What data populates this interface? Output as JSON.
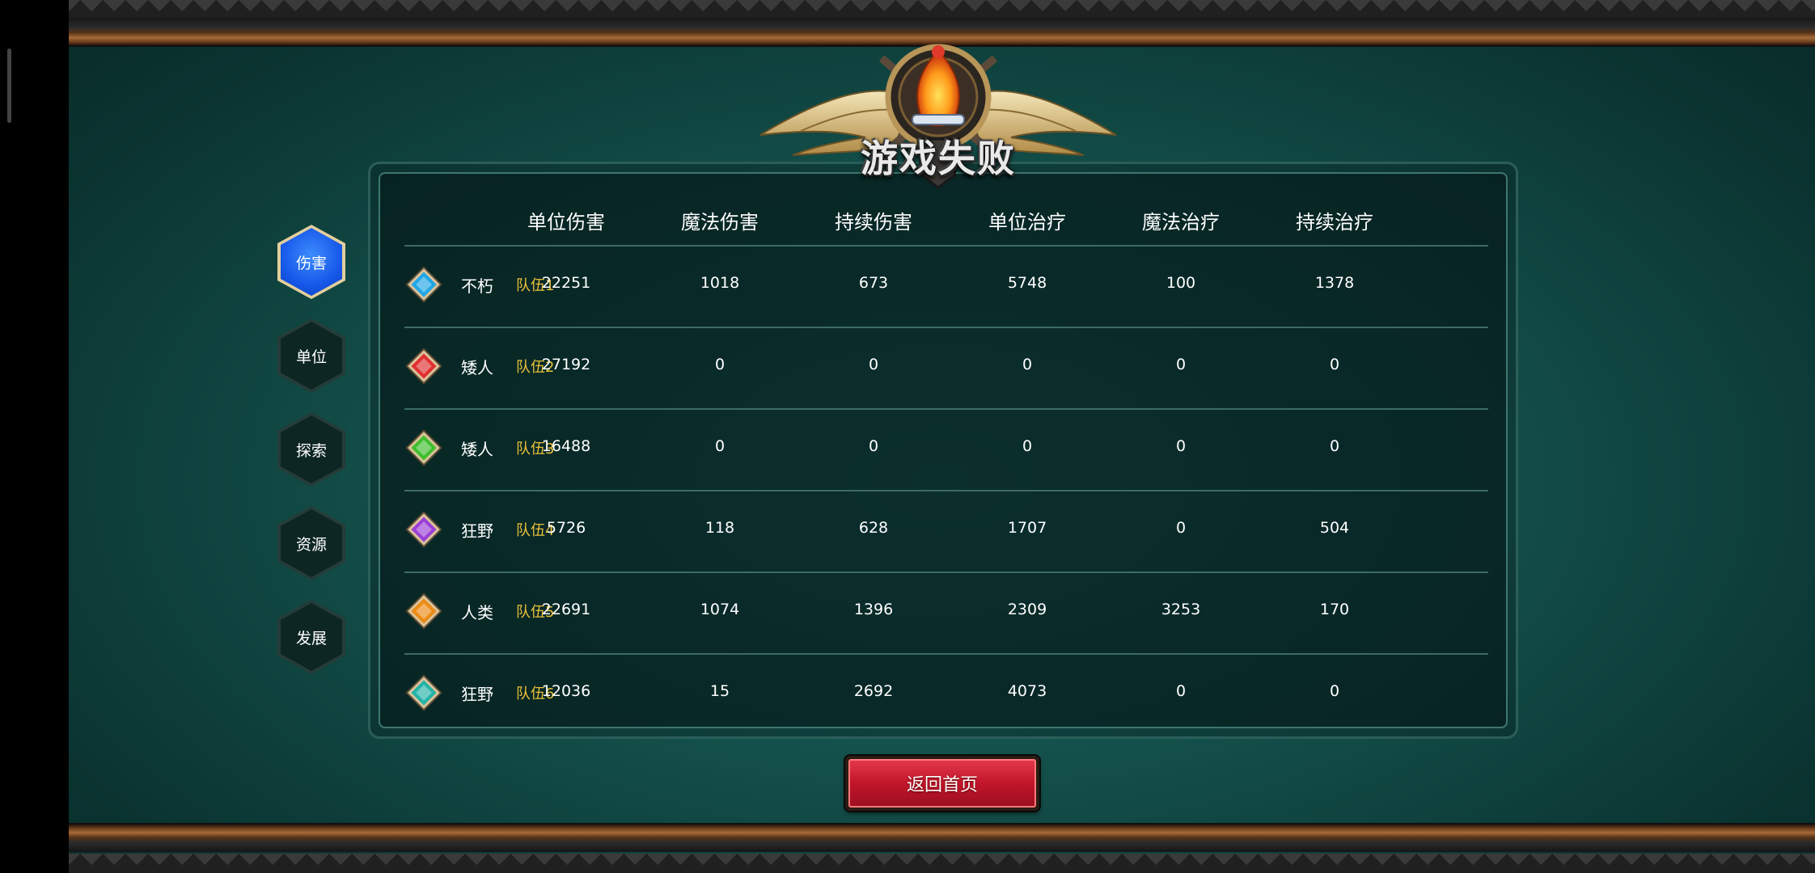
{
  "result_title": "游戏失败",
  "tabs": [
    {
      "label": "伤害",
      "active": true
    },
    {
      "label": "单位",
      "active": false
    },
    {
      "label": "探索",
      "active": false
    },
    {
      "label": "资源",
      "active": false
    },
    {
      "label": "发展",
      "active": false
    }
  ],
  "table": {
    "headers": [
      "单位伤害",
      "魔法伤害",
      "持续伤害",
      "单位治疗",
      "魔法治疗",
      "持续治疗"
    ],
    "rows": [
      {
        "gem_color": "#1fa6e6",
        "race": "不朽",
        "team": "队伍1",
        "values": [
          "22251",
          "1018",
          "673",
          "5748",
          "100",
          "1378"
        ]
      },
      {
        "gem_color": "#e13030",
        "race": "矮人",
        "team": "队伍2",
        "values": [
          "27192",
          "0",
          "0",
          "0",
          "0",
          "0"
        ]
      },
      {
        "gem_color": "#3fbf2e",
        "race": "矮人",
        "team": "队伍3",
        "values": [
          "16488",
          "0",
          "0",
          "0",
          "0",
          "0"
        ]
      },
      {
        "gem_color": "#9b3fd6",
        "race": "狂野",
        "team": "队伍4",
        "values": [
          "5726",
          "118",
          "628",
          "1707",
          "0",
          "504"
        ]
      },
      {
        "gem_color": "#ec8a14",
        "race": "人类",
        "team": "队伍5",
        "values": [
          "22691",
          "1074",
          "1396",
          "2309",
          "3253",
          "170"
        ]
      },
      {
        "gem_color": "#23b3a8",
        "race": "狂野",
        "team": "队伍6",
        "values": [
          "12036",
          "15",
          "2692",
          "4073",
          "0",
          "0"
        ]
      }
    ]
  },
  "buttons": {
    "return_home": "返回首页"
  },
  "colors": {
    "team_label": "#e8c13a",
    "active_tab": "#1657e8",
    "button_red": "#c2152a"
  }
}
